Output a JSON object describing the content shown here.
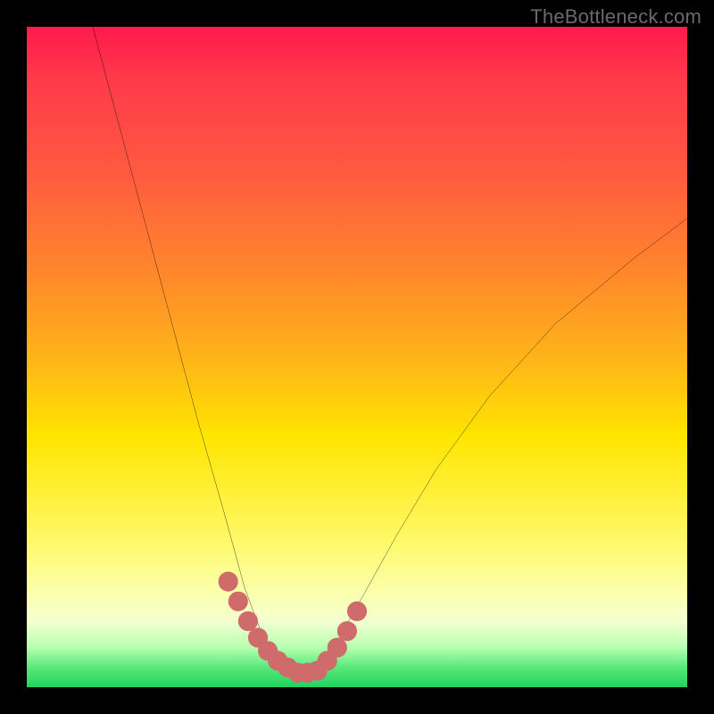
{
  "watermark": "TheBottleneck.com",
  "chart_data": {
    "type": "line",
    "title": "",
    "xlabel": "",
    "ylabel": "",
    "xlim": [
      0,
      100
    ],
    "ylim": [
      0,
      100
    ],
    "note": "x and y are percent of plot width/height; y increases downward visually (0=top). Background color encodes bottleneck severity (red high, green low).",
    "series": [
      {
        "name": "bottleneck-curve-left",
        "x": [
          10,
          14,
          18,
          22,
          26,
          30,
          33,
          36,
          38.5
        ],
        "y": [
          0,
          15,
          30,
          45,
          60,
          74,
          85,
          93,
          97.5
        ]
      },
      {
        "name": "bottleneck-curve-right",
        "x": [
          44,
          47,
          51,
          56,
          62,
          70,
          80,
          92,
          100
        ],
        "y": [
          97.5,
          93,
          86,
          77,
          67,
          56,
          45,
          35,
          29
        ]
      },
      {
        "name": "valley-floor",
        "x": [
          38.5,
          40,
          41.5,
          43,
          44
        ],
        "y": [
          97.5,
          98.3,
          98.5,
          98.3,
          97.5
        ]
      }
    ],
    "markers": [
      {
        "name": "left-side-dots",
        "x": [
          30.5,
          32,
          33.5,
          35,
          36.5,
          38,
          39.5,
          41
        ],
        "y": [
          84,
          87,
          90,
          92.5,
          94.5,
          96,
          97,
          97.8
        ]
      },
      {
        "name": "floor-dots",
        "x": [
          41,
          42.5,
          44
        ],
        "y": [
          97.8,
          97.8,
          97.5
        ]
      },
      {
        "name": "right-side-dots",
        "x": [
          45.5,
          47,
          48.5,
          50
        ],
        "y": [
          96,
          94,
          91.5,
          88.5
        ]
      }
    ],
    "marker_style": {
      "color": "#cf6b6b",
      "radius_pct": 1.5
    },
    "gradient_stops": [
      {
        "pos": 0,
        "color": "#ff1a4d"
      },
      {
        "pos": 38,
        "color": "#ff8a2a"
      },
      {
        "pos": 62,
        "color": "#ffe500"
      },
      {
        "pos": 90,
        "color": "#f4ffd0"
      },
      {
        "pos": 100,
        "color": "#1fd45f"
      }
    ]
  }
}
